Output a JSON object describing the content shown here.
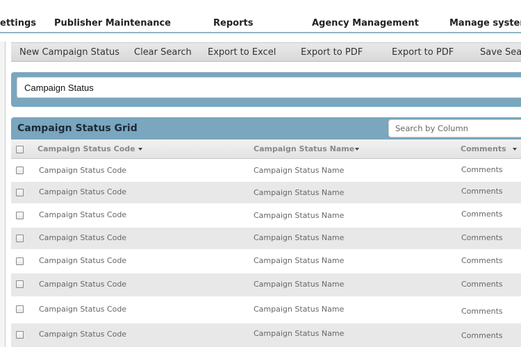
{
  "topnav": {
    "items": [
      {
        "label": "ettings"
      },
      {
        "label": "Publisher Maintenance"
      },
      {
        "label": "Reports"
      },
      {
        "label": "Agency Management"
      },
      {
        "label": "Manage system"
      }
    ]
  },
  "toolbar": {
    "buttons": [
      {
        "label": "New Campaign Status"
      },
      {
        "label": "Clear Search"
      },
      {
        "label": "Export to Excel"
      },
      {
        "label": "Export to PDF"
      },
      {
        "label": "Export to PDF"
      },
      {
        "label": "Save Sear"
      }
    ]
  },
  "search": {
    "field_label": "Campaign Status"
  },
  "grid": {
    "title": "Campaign Status Grid",
    "column_search_placeholder": "Search by Column",
    "columns": [
      {
        "label": "Campaign Status Code"
      },
      {
        "label": "Campaign Status Name"
      },
      {
        "label": "Comments"
      }
    ],
    "rows": [
      {
        "code": "Campaign Status Code",
        "name": "Campaign Status Name",
        "comments": "Comments"
      },
      {
        "code": "Campaign Status Code",
        "name": "Campaign Status Name",
        "comments": "Comments"
      },
      {
        "code": "Campaign Status Code",
        "name": "Campaign Status Name",
        "comments": "Comments"
      },
      {
        "code": "Campaign Status Code",
        "name": "Campaign Status Name",
        "comments": "Comments"
      },
      {
        "code": "Campaign Status Code",
        "name": "Campaign Status Name",
        "comments": "Comments"
      },
      {
        "code": "Campaign Status Code",
        "name": "Campaign Status Name",
        "comments": "Comments"
      },
      {
        "code": "Campaign Status Code",
        "name": "Campaign Status Name",
        "comments": "Comments"
      },
      {
        "code": "Campaign Status Code",
        "name": "Campaign Status Name",
        "comments": "Comments"
      }
    ]
  },
  "colors": {
    "accent": "#7aa6be",
    "row_alt": "#e8e8e8"
  }
}
